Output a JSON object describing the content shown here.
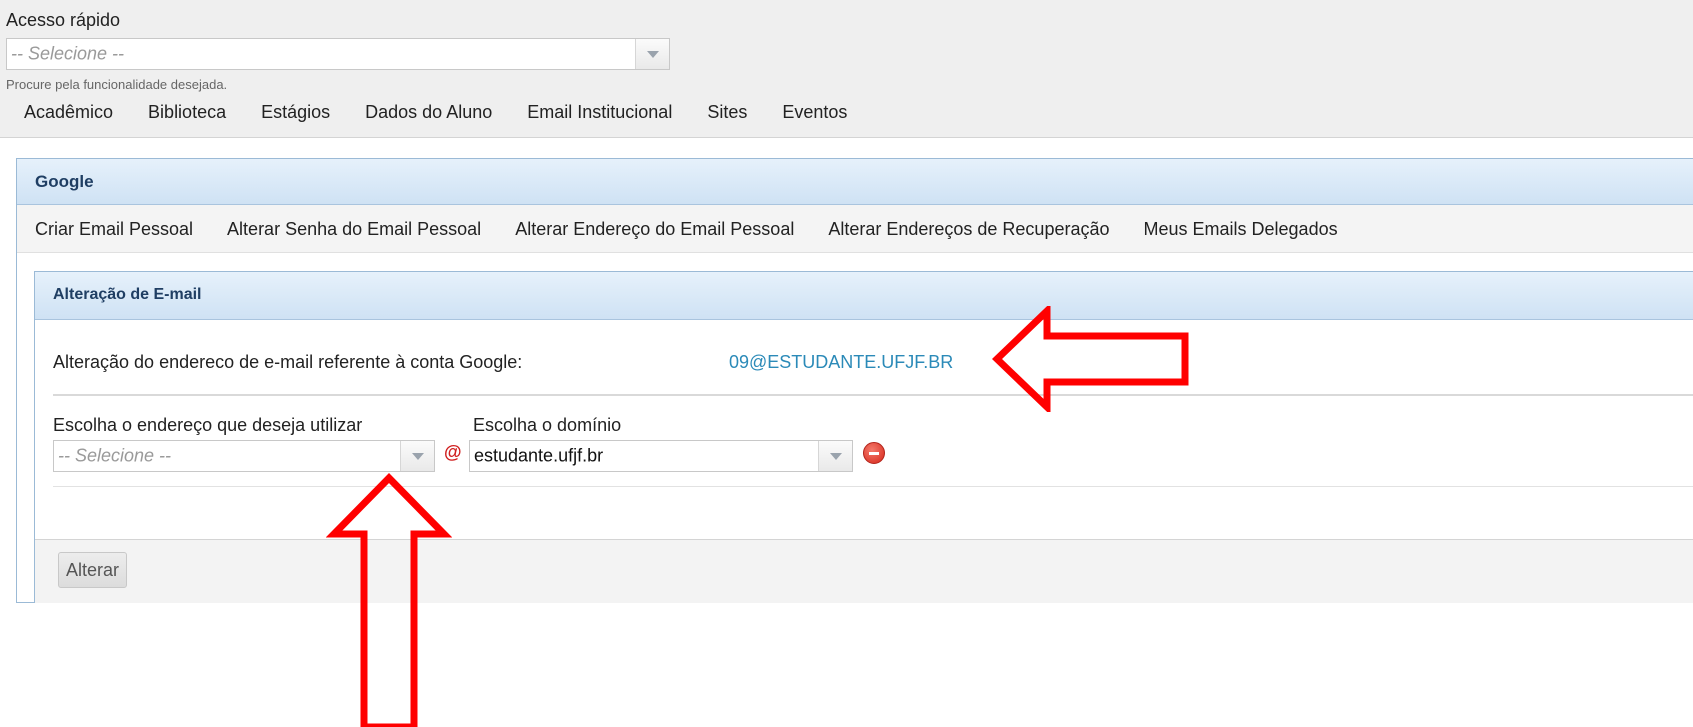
{
  "quick_access": {
    "label": "Acesso rápido",
    "select_placeholder": "-- Selecione --",
    "help": "Procure pela funcionalidade desejada."
  },
  "main_nav": [
    "Acadêmico",
    "Biblioteca",
    "Estágios",
    "Dados do Aluno",
    "Email Institucional",
    "Sites",
    "Eventos"
  ],
  "panel": {
    "title": "Google",
    "tabs": [
      "Criar Email Pessoal",
      "Alterar Senha do Email Pessoal",
      "Alterar Endereço do Email Pessoal",
      "Alterar Endereços de Recuperação",
      "Meus Emails Delegados"
    ]
  },
  "form": {
    "title": "Alteração de E-mail",
    "current_label": "Alteração do endereco de e-mail referente à conta Google:",
    "current_email": "09@ESTUDANTE.UFJF.BR",
    "address_label": "Escolha o endereço que deseja utilizar",
    "address_placeholder": "-- Selecione --",
    "at_symbol": "@",
    "domain_label": "Escolha o domínio",
    "domain_value": "estudante.ufjf.br",
    "submit_label": "Alterar"
  },
  "annotation_color": "#ff0000",
  "icons": [
    "dropdown-arrow-icon",
    "remove-icon",
    "red-arrow-annotation"
  ]
}
